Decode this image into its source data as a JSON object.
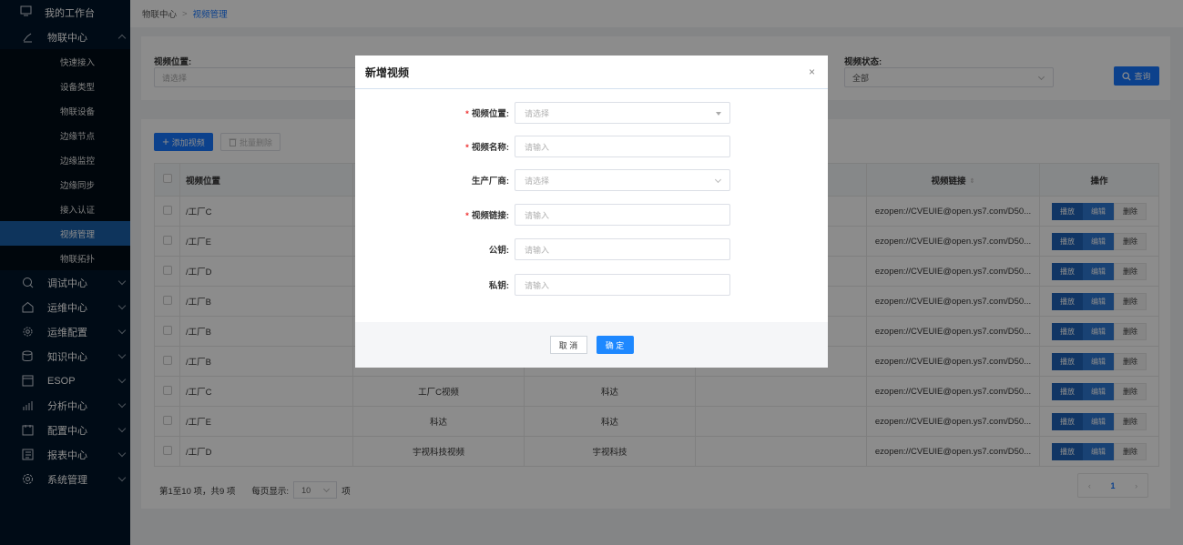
{
  "sidebar": {
    "top": "我的工作台",
    "groups": [
      {
        "label": "物联中心",
        "icon": "iot-icon",
        "expanded": true
      },
      {
        "label": "调试中心",
        "icon": "debug-icon"
      },
      {
        "label": "运维中心",
        "icon": "ops-icon"
      },
      {
        "label": "运维配置",
        "icon": "ops-config-icon"
      },
      {
        "label": "知识中心",
        "icon": "knowledge-icon"
      },
      {
        "label": "ESOP",
        "icon": "esop-icon"
      },
      {
        "label": "分析中心",
        "icon": "analysis-icon"
      },
      {
        "label": "配置中心",
        "icon": "config-icon"
      },
      {
        "label": "报表中心",
        "icon": "report-icon"
      },
      {
        "label": "系统管理",
        "icon": "settings-icon"
      }
    ],
    "subitems": [
      "快速接入",
      "设备类型",
      "物联设备",
      "边缘节点",
      "边缘监控",
      "边缘同步",
      "接入认证",
      "视频管理",
      "物联拓扑"
    ],
    "active_sub": "视频管理"
  },
  "breadcrumb": {
    "parent": "物联中心",
    "sep": ">",
    "current": "视频管理"
  },
  "filter": {
    "location_label": "视频位置:",
    "location_placeholder": "请选择",
    "status_label": "视频状态:",
    "status_value": "全部",
    "query_label": "查询"
  },
  "toolbar": {
    "add_label": "添加视频",
    "batch_delete_label": "批量删除"
  },
  "table": {
    "headers": {
      "location": "视频位置",
      "link": "视频链接",
      "ops": "操作"
    },
    "rows": [
      {
        "location": "/工厂C",
        "name": "",
        "vendor": "",
        "link": "ezopen://CVEUIE@open.ys7.com/D50..."
      },
      {
        "location": "/工厂E",
        "name": "",
        "vendor": "",
        "link": "ezopen://CVEUIE@open.ys7.com/D50..."
      },
      {
        "location": "/工厂D",
        "name": "",
        "vendor": "",
        "link": "ezopen://CVEUIE@open.ys7.com/D50..."
      },
      {
        "location": "/工厂B",
        "name": "",
        "vendor": "",
        "link": "ezopen://CVEUIE@open.ys7.com/D50..."
      },
      {
        "location": "/工厂B",
        "name": "",
        "vendor": "",
        "link": "ezopen://CVEUIE@open.ys7.com/D50..."
      },
      {
        "location": "/工厂B",
        "name": "",
        "vendor": "",
        "link": "ezopen://CVEUIE@open.ys7.com/D50..."
      },
      {
        "location": "/工厂C",
        "name": "工厂C视频",
        "vendor": "科达",
        "link": "ezopen://CVEUIE@open.ys7.com/D50..."
      },
      {
        "location": "/工厂E",
        "name": "科达",
        "vendor": "科达",
        "link": "ezopen://CVEUIE@open.ys7.com/D50..."
      },
      {
        "location": "/工厂D",
        "name": "宇视科技视频",
        "vendor": "宇视科技",
        "link": "ezopen://CVEUIE@open.ys7.com/D50..."
      }
    ],
    "op_play": "播放",
    "op_edit": "编辑",
    "op_delete": "删除"
  },
  "footer": {
    "summary": "第1至10 项，共9 项",
    "per_page_label": "每页显示:",
    "per_page_value": "10",
    "per_page_unit": "项",
    "current_page": "1"
  },
  "modal": {
    "title": "新增视频",
    "close": "×",
    "fields": [
      {
        "label": "视频位置:",
        "required": "*",
        "placeholder": "请选择",
        "type": "tree-select"
      },
      {
        "label": "视频名称:",
        "required": "*",
        "placeholder": "请输入",
        "type": "input"
      },
      {
        "label": "生产厂商:",
        "required": "",
        "placeholder": "请选择",
        "type": "select"
      },
      {
        "label": "视频链接:",
        "required": "*",
        "placeholder": "请输入",
        "type": "input"
      },
      {
        "label": "公钥:",
        "required": "",
        "placeholder": "请输入",
        "type": "input"
      },
      {
        "label": "私钥:",
        "required": "",
        "placeholder": "请输入",
        "type": "input"
      }
    ],
    "cancel_label": "取 消",
    "ok_label": "确 定"
  },
  "colors": {
    "sidebar_bg": "#001529",
    "accent": "#1677ff",
    "active_nav": "#1a5fa8"
  }
}
